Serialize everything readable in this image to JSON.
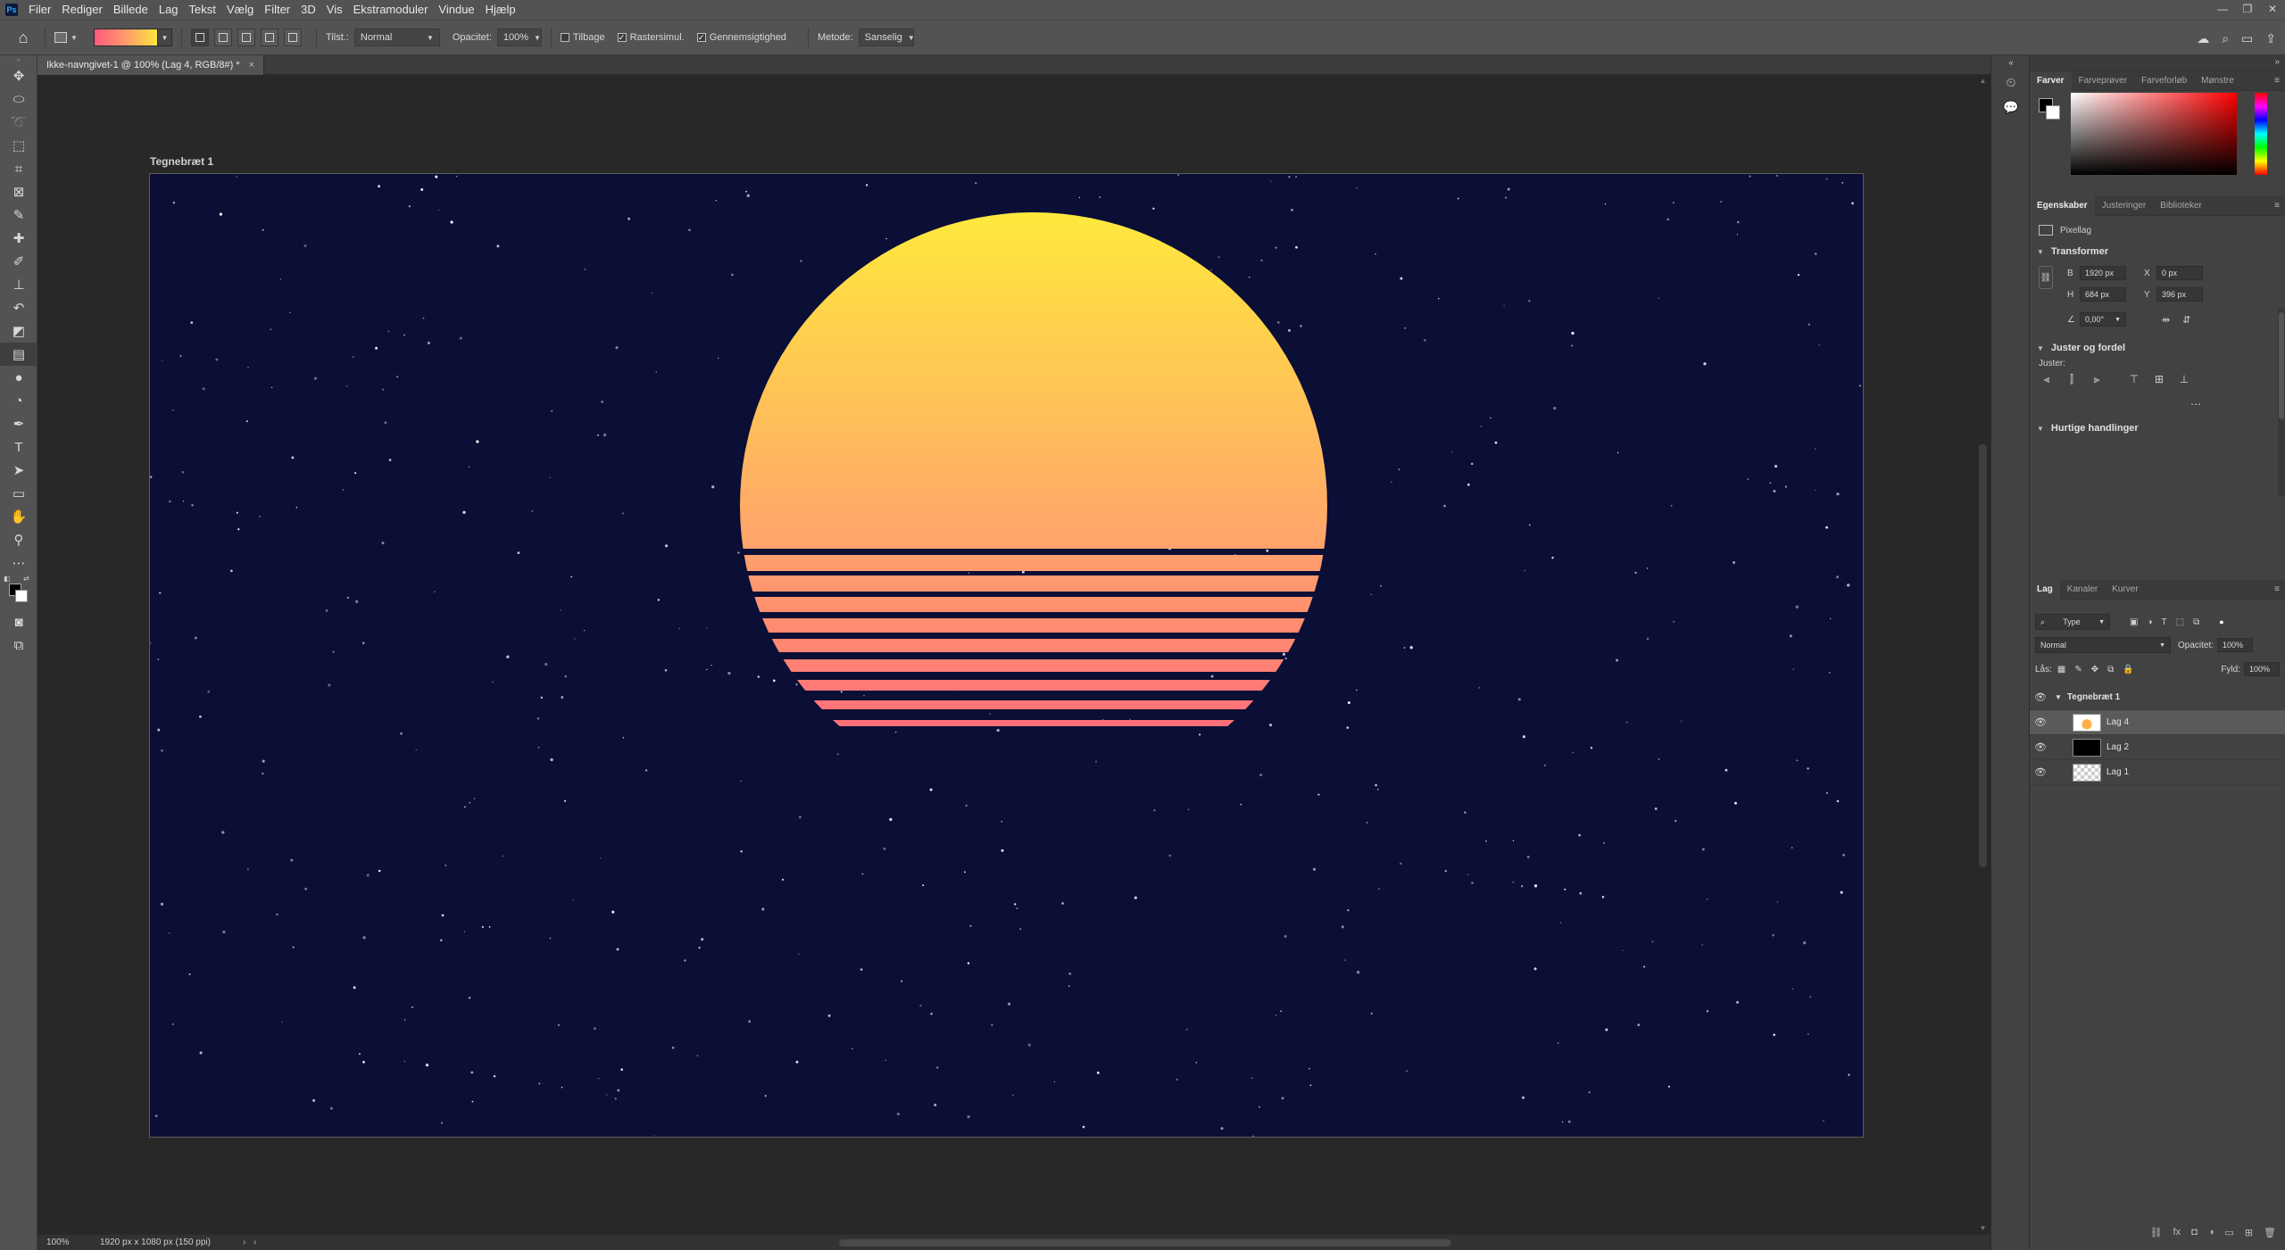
{
  "app": {
    "logo": "Ps"
  },
  "menu": [
    "Filer",
    "Rediger",
    "Billede",
    "Lag",
    "Tekst",
    "Vælg",
    "Filter",
    "3D",
    "Vis",
    "Ekstramoduler",
    "Vindue",
    "Hjælp"
  ],
  "window_controls": [
    "—",
    "❐",
    "✕"
  ],
  "options": {
    "mode_label": "Tilst.:",
    "mode_value": "Normal",
    "opacity_label": "Opacitet:",
    "opacity_value": "100%",
    "reverse_label": "Tilbage",
    "dither_label": "Rastersimul.",
    "transparency_label": "Gennemsigtighed",
    "method_label": "Metode:",
    "method_value": "Sanselig"
  },
  "document": {
    "tab_title": "Ikke-navngivet-1 @ 100% (Lag 4, RGB/8#) *",
    "artboard_label": "Tegnebræt 1"
  },
  "status": {
    "zoom": "100%",
    "info": "1920 px x 1080 px (150 ppi)"
  },
  "colors_panel": {
    "tabs": [
      "Farver",
      "Farveprøver",
      "Farveforløb",
      "Mønstre"
    ]
  },
  "properties_panel": {
    "tabs": [
      "Egenskaber",
      "Justeringer",
      "Biblioteker"
    ],
    "layer_type": "Pixellag",
    "transform_title": "Transformer",
    "w_label": "B",
    "w_value": "1920 px",
    "h_label": "H",
    "h_value": "684 px",
    "x_label": "X",
    "x_value": "0 px",
    "y_label": "Y",
    "y_value": "396 px",
    "angle_value": "0,00°",
    "align_title": "Juster og fordel",
    "align_sub": "Juster:",
    "quick_title": "Hurtige handlinger"
  },
  "layers_panel": {
    "tabs": [
      "Lag",
      "Kanaler",
      "Kurver"
    ],
    "filter_value": "Type",
    "blend_value": "Normal",
    "opacity_label": "Opacitet:",
    "opacity_value": "100%",
    "lock_label": "Lås:",
    "fill_label": "Fyld:",
    "fill_value": "100%",
    "group_name": "Tegnebræt 1",
    "layers": [
      {
        "name": "Lag 4"
      },
      {
        "name": "Lag 2"
      },
      {
        "name": "Lag 1"
      }
    ]
  },
  "canvas_colors": {
    "sky": "#0b0e35",
    "sun_top": "#ffe93d",
    "sun_mid": "#ffa66a",
    "sun_bottom": "#ff5a7e"
  }
}
